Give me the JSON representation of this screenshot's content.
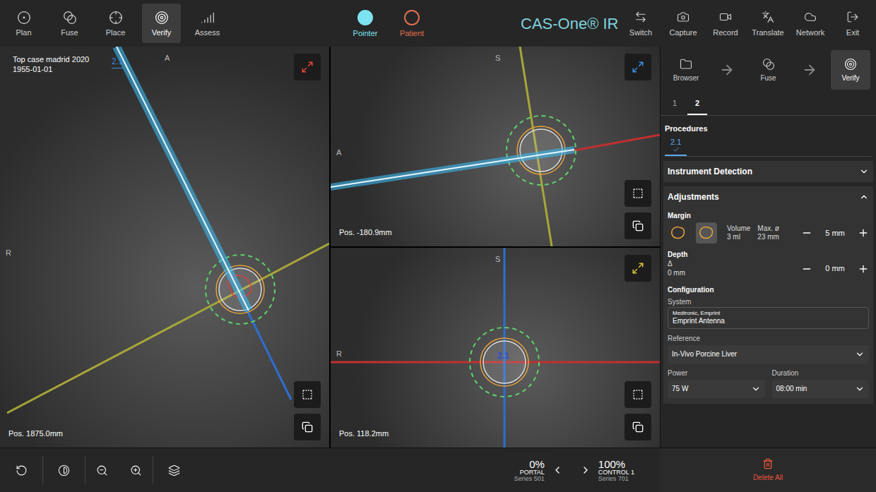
{
  "toolbar": {
    "left": [
      {
        "label": "Plan",
        "selected": false
      },
      {
        "label": "Fuse",
        "selected": false
      },
      {
        "label": "Place",
        "selected": false
      },
      {
        "label": "Verify",
        "selected": true
      },
      {
        "label": "Assess",
        "selected": false
      }
    ],
    "modes": [
      {
        "label": "Pointer",
        "selected": true,
        "color": "#7ee3f0"
      },
      {
        "label": "Patient",
        "selected": false,
        "color": "#e0704f"
      }
    ],
    "title": "CAS-One® IR",
    "right": [
      {
        "label": "Switch"
      },
      {
        "label": "Capture"
      },
      {
        "label": "Record"
      },
      {
        "label": "Translate"
      },
      {
        "label": "Network"
      },
      {
        "label": "Exit"
      }
    ]
  },
  "viewports": [
    {
      "patient_name": "Top case madrid 2020",
      "patient_dob": "1955-01-01",
      "trajectory_label": "2.1",
      "orientation_top": "A",
      "orientation_left": "R",
      "position": "Pos. 1875.0mm",
      "color": "#e8453c"
    },
    {
      "orientation_top": "S",
      "orientation_left": "A",
      "position": "Pos. -180.9mm",
      "color": "#3b8fe0"
    },
    {
      "orientation_top": "S",
      "orientation_left": "R",
      "trajectory_label": "2.1",
      "position": "Pos. 118.2mm",
      "color": "#d9c43a"
    }
  ],
  "workflow": [
    {
      "label": "Browser",
      "selected": false
    },
    {
      "label": "Fuse",
      "selected": false
    },
    {
      "label": "Verify",
      "selected": true
    }
  ],
  "tabs": [
    {
      "label": "1",
      "selected": false
    },
    {
      "label": "2",
      "selected": true
    }
  ],
  "procedures": {
    "title": "Procedures",
    "items": [
      {
        "label": "2.1",
        "selected": true,
        "verified": true
      }
    ]
  },
  "sections": [
    {
      "title": "Instrument Detection",
      "expanded": false
    },
    {
      "title": "Adjustments",
      "expanded": true
    }
  ],
  "margin": {
    "title": "Margin",
    "shapes": [
      {
        "selected": false
      },
      {
        "selected": true
      }
    ],
    "volume_label": "Volume",
    "volume": "3 ml",
    "max_label": "Max. ø",
    "max": "23 mm",
    "value": "5 mm"
  },
  "depth": {
    "title": "Depth",
    "delta": "Δ",
    "reading": "0 mm",
    "value": "0 mm"
  },
  "configuration": {
    "title": "Configuration",
    "system_label": "System",
    "system_vendor": "Medtronic, Emprint",
    "system_name": "Emprint Antenna",
    "reference_label": "Reference",
    "reference": "In-Vivo Porcine Liver",
    "power_label": "Power",
    "power": "75 W",
    "duration_label": "Duration",
    "duration": "08:00 min"
  },
  "series": [
    {
      "percent": "0%",
      "name": "PORTAL",
      "series": "Series 501"
    },
    {
      "percent": "100%",
      "name": "CONTROL 1",
      "series": "Series 701"
    }
  ],
  "delete_all": "Delete All"
}
